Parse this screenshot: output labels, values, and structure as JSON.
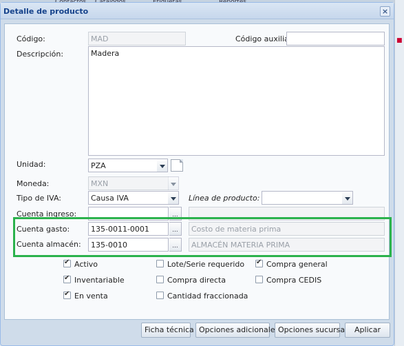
{
  "background": {
    "tabs": [
      "Contactos",
      "Catálogos",
      "Etiquetas",
      "Reportes"
    ]
  },
  "dialog": {
    "title": "Detalle de producto",
    "close_icon": "close-icon"
  },
  "form": {
    "codigo": {
      "label": "Código:",
      "value": "MAD"
    },
    "codigo_auxiliar": {
      "label": "Código auxiliar:",
      "value": ""
    },
    "descripcion": {
      "label": "Descripción:",
      "value": "Madera"
    },
    "unidad": {
      "label": "Unidad:",
      "value": "PZA"
    },
    "moneda": {
      "label": "Moneda:",
      "value": "MXN"
    },
    "tipo_iva": {
      "label": "Tipo de IVA:",
      "value": "Causa IVA"
    },
    "linea_producto": {
      "label": "Línea de producto:",
      "value": ""
    },
    "cuenta_ingreso": {
      "label": "Cuenta ingreso:",
      "value": "",
      "description": ""
    },
    "cuenta_gasto": {
      "label": "Cuenta gasto:",
      "value": "135-0011-0001",
      "description": "Costo de materia prima"
    },
    "cuenta_almacen": {
      "label": "Cuenta almacén:",
      "value": "135-0010",
      "description": "ALMACÉN MATERIA PRIMA"
    },
    "trigger_label": "..."
  },
  "checkboxes": [
    {
      "label": "Activo",
      "checked": true
    },
    {
      "label": "Inventariable",
      "checked": true
    },
    {
      "label": "En venta",
      "checked": true
    },
    {
      "label": "Lote/Serie requerido",
      "checked": false
    },
    {
      "label": "Compra directa",
      "checked": false
    },
    {
      "label": "Cantidad fraccionada",
      "checked": false
    },
    {
      "label": "Compra general",
      "checked": true
    },
    {
      "label": "Compra CEDIS",
      "checked": false
    }
  ],
  "footer": {
    "buttons": [
      "Ficha técnica",
      "Opciones adicionales",
      "Opciones sucursal",
      "Aplicar"
    ]
  },
  "colors": {
    "highlight": "#2bb24c",
    "title": "#15428b"
  }
}
